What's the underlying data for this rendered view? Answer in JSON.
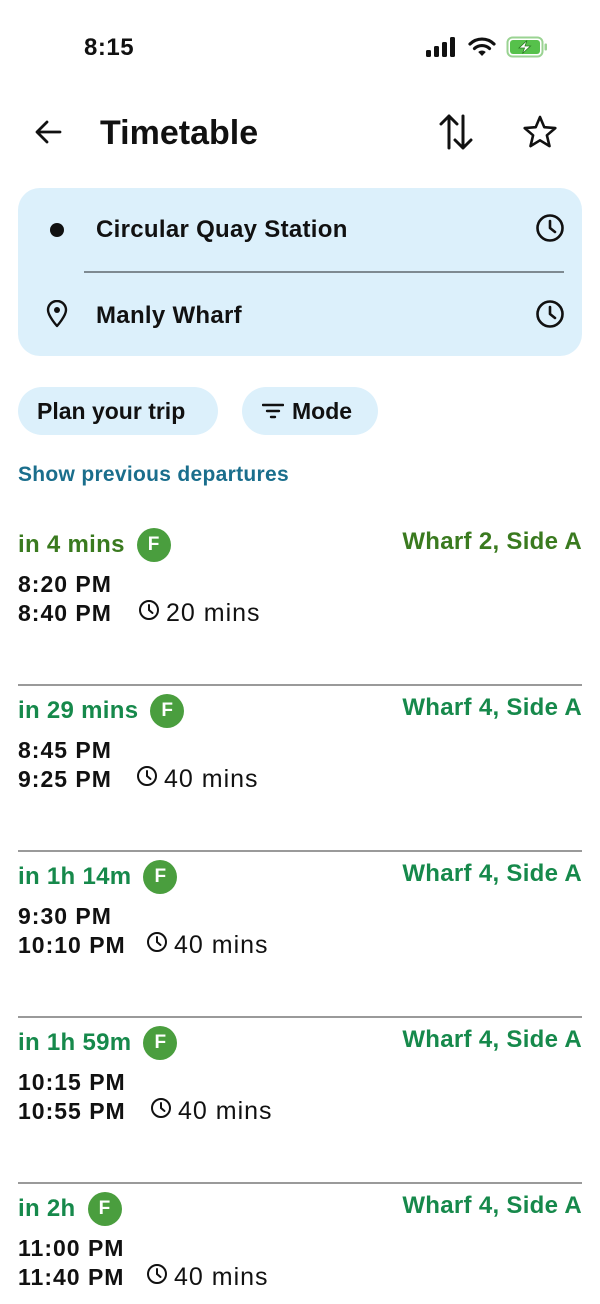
{
  "status_bar": {
    "time": "8:15",
    "battery_color": "#56c14b"
  },
  "header": {
    "title": "Timetable"
  },
  "route": {
    "origin": "Circular Quay Station",
    "destination": "Manly Wharf"
  },
  "chips": {
    "plan": "Plan your trip",
    "mode": "Mode"
  },
  "links": {
    "previous": "Show previous departures"
  },
  "colors": {
    "eta_dark": "#3a7a1f",
    "eta": "#16894b",
    "wharf": "#16894b",
    "wharf_dark": "#3a7a1f",
    "ferry_badge": "#4a9e3e"
  },
  "departures": [
    {
      "eta": "in 4 mins",
      "badge": "F",
      "wharf": "Wharf 2, Side A",
      "depart": "8:20 PM",
      "arrive": "8:40 PM",
      "duration": "20 mins"
    },
    {
      "eta": "in 29 mins",
      "badge": "F",
      "wharf": "Wharf 4, Side A",
      "depart": "8:45 PM",
      "arrive": "9:25 PM",
      "duration": "40 mins"
    },
    {
      "eta": "in 1h 14m",
      "badge": "F",
      "wharf": "Wharf 4, Side A",
      "depart": "9:30 PM",
      "arrive": "10:10 PM",
      "duration": "40 mins"
    },
    {
      "eta": "in 1h 59m",
      "badge": "F",
      "wharf": "Wharf 4, Side A",
      "depart": "10:15 PM",
      "arrive": "10:55 PM",
      "duration": "40 mins"
    },
    {
      "eta": "in 2h",
      "badge": "F",
      "wharf": "Wharf 4, Side A",
      "depart": "11:00 PM",
      "arrive": "11:40 PM",
      "duration": "40 mins"
    }
  ]
}
